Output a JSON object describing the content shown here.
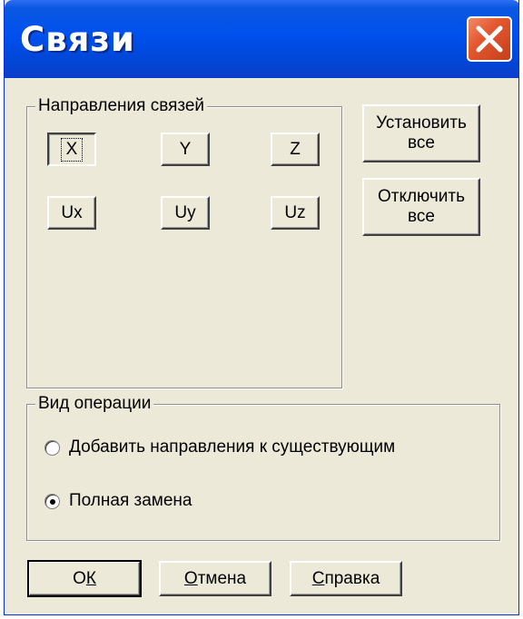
{
  "window": {
    "title": "Связи",
    "close_icon": "close-x-icon"
  },
  "directions": {
    "legend": "Направления связей",
    "buttons": [
      {
        "label": "X",
        "pressed": true
      },
      {
        "label": "Y",
        "pressed": false
      },
      {
        "label": "Z",
        "pressed": false
      },
      {
        "label": "Ux",
        "pressed": false
      },
      {
        "label": "Uy",
        "pressed": false
      },
      {
        "label": "Uz",
        "pressed": false
      }
    ]
  },
  "side_buttons": {
    "set_all_line1": "Установить",
    "set_all_line2": "все",
    "disable_all_line1": "Отключить",
    "disable_all_line2": "все"
  },
  "operation": {
    "legend": "Вид операции",
    "options": [
      {
        "label": "Добавить направления к существующим",
        "selected": false
      },
      {
        "label": "Полная замена",
        "selected": true
      }
    ]
  },
  "footer": {
    "ok_prefix": "О",
    "ok_accel": "К",
    "cancel_accel": "О",
    "cancel_rest": "тмена",
    "help_accel": "С",
    "help_rest": "правка"
  },
  "colors": {
    "titlebar": "#0050ee",
    "face": "#ece9d8",
    "close": "#e2582f"
  }
}
